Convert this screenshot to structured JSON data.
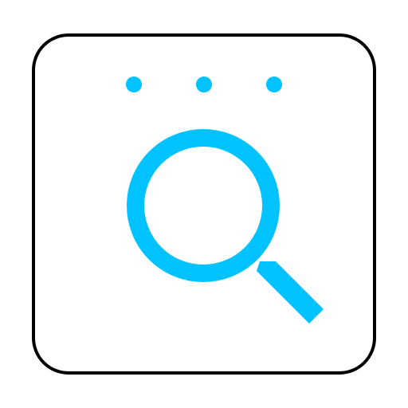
{
  "icon": {
    "name": "search-window-icon",
    "frame_stroke_color": "#000000",
    "frame_fill_color": "#ffffff",
    "accent_color": "#00C2FF",
    "dots_count": 3,
    "glyph": "magnifying-glass"
  }
}
